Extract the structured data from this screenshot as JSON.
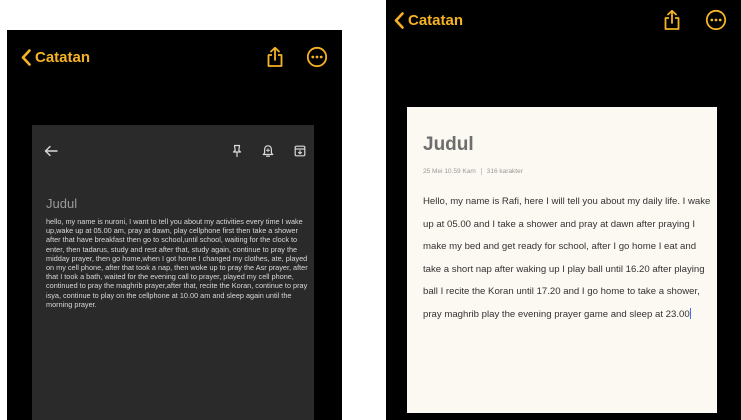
{
  "colors": {
    "accent": "#f5b324",
    "screen_background": "#000000",
    "dark_card": "#2a2a2a",
    "light_card": "#fcf8f2",
    "caret": "#3b6cf5"
  },
  "left_screen": {
    "nav": {
      "back_label": "Catatan",
      "icons": [
        "share-icon",
        "more-options-icon"
      ]
    },
    "editor": {
      "toolbar_icons": [
        "back-arrow-icon",
        "pin-icon",
        "reminder-bell-icon",
        "archive-icon"
      ],
      "title": "Judul",
      "body": "hello, my name is nuroni, I want to tell you about my activities every time I wake up,wake up at 05.00 am, pray at dawn, play cellphone first then take a shower after that have breakfast then go to school,until school, waiting for the clock to enter, then tadarus, study and rest after that, study again, continue to pray the midday prayer, then go home,when I got home I changed my clothes, ate, played on my cell phone, after that took a nap, then woke up to pray the Asr prayer, after that I took a bath, waited for the evening call to prayer, played my cell phone, continued to pray the maghrib prayer,after that, recite the Koran, continue to pray isya, continue to play on the cellphone at 10.00 am and sleep again until the morning prayer."
    }
  },
  "right_screen": {
    "nav": {
      "back_label": "Catatan",
      "icons": [
        "share-icon",
        "more-options-icon"
      ]
    },
    "note": {
      "title": "Judul",
      "date": "25 Mei 10.59 Kam",
      "char_count": "316 karakter",
      "body": "Hello, my name is Rafi, here I will tell you about my daily life. I wake up at 05.00 and I take a shower and pray at dawn after praying I make my bed and get ready for school, after I go home I eat and take a short nap after waking up I play ball until 16.20 after playing ball I recite the Koran until 17.20 and I go home to take a shower, pray maghrib play the evening prayer game and sleep at 23.00"
    }
  }
}
